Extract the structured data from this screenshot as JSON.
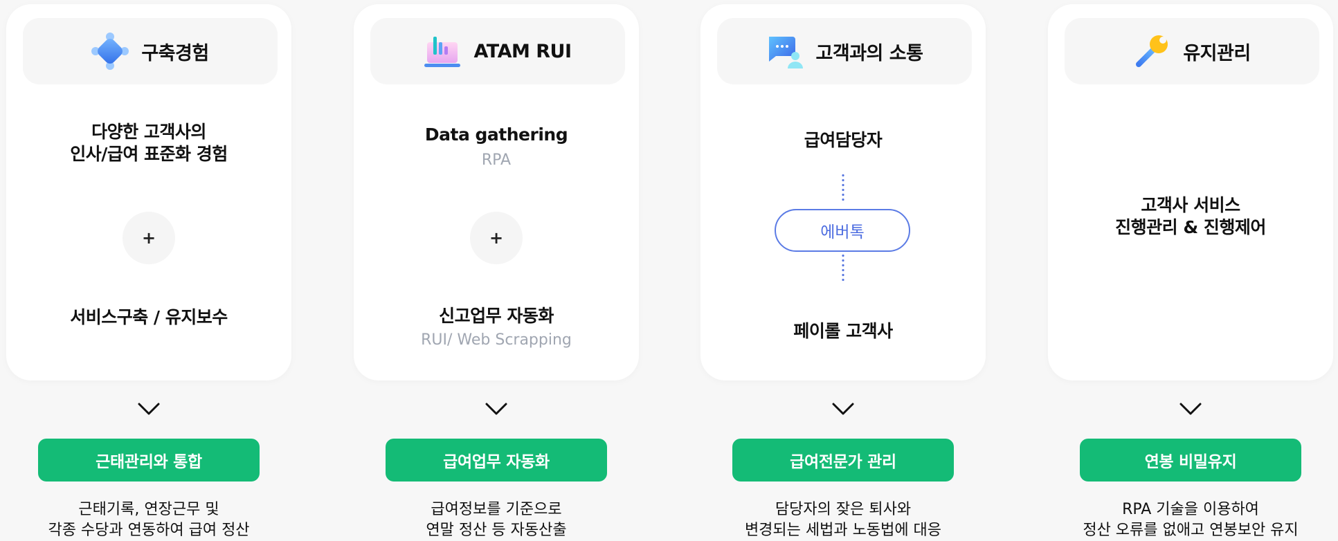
{
  "columns": [
    {
      "title": "구축경험",
      "icon": "puzzle-icon",
      "top_lines": [
        "다양한 고객사의",
        "인사/급여 표준화 경험"
      ],
      "plus": "+",
      "bottom_main": "서비스구축 / 유지보수",
      "button": "근태관리와 통합",
      "desc": [
        "근태기록, 연장근무 및",
        "각종 수당과 연동하여 급여 정산"
      ]
    },
    {
      "title": "ATAM RUI",
      "icon": "laptop-chart-icon",
      "top_main": "Data gathering",
      "top_sub": "RPA",
      "plus": "+",
      "bottom_main": "신고업무 자동화",
      "bottom_sub": "RUI/ Web Scrapping",
      "button": "급여업무 자동화",
      "desc": [
        "급여정보를 기준으로",
        "연말 정산 등 자동산출"
      ]
    },
    {
      "title": "고객과의 소통",
      "icon": "chat-person-icon",
      "top_main": "급여담당자",
      "pill": "에버톡",
      "bottom_main": "페이롤 고객사",
      "button": "급여전문가 관리",
      "desc": [
        "담당자의 잦은 퇴사와",
        "변경되는 세법과 노동법에 대응"
      ]
    },
    {
      "title": "유지관리",
      "icon": "wrench-icon",
      "center_lines": [
        "고객사 서비스",
        "진행관리 & 진행제어"
      ],
      "button": "연봉 비밀유지",
      "desc": [
        "RPA 기술을 이용하여",
        "정산 오류를 없애고 연봉보안 유지"
      ]
    }
  ],
  "colors": {
    "button_bg": "#14bb76",
    "accent_blue": "#5b7be5",
    "sub_text": "#a0a6b1",
    "page_bg": "#f7f7f7"
  }
}
